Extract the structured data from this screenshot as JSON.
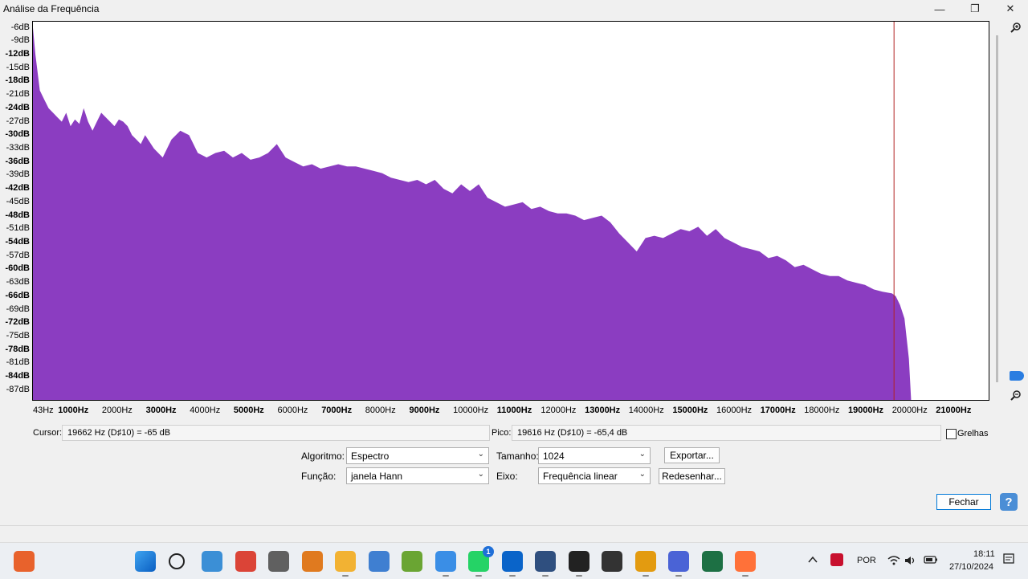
{
  "window": {
    "title": "Análise da Frequência",
    "minimize_glyph": "—",
    "maximize_glyph": "❐",
    "close_glyph": "✕"
  },
  "y_axis": {
    "ticks": [
      "-6dB",
      "-9dB",
      "-12dB",
      "-15dB",
      "-18dB",
      "-21dB",
      "-24dB",
      "-27dB",
      "-30dB",
      "-33dB",
      "-36dB",
      "-39dB",
      "-42dB",
      "-45dB",
      "-48dB",
      "-51dB",
      "-54dB",
      "-57dB",
      "-60dB",
      "-63dB",
      "-66dB",
      "-69dB",
      "-72dB",
      "-75dB",
      "-78dB",
      "-81dB",
      "-84dB",
      "-87dB"
    ]
  },
  "x_axis": {
    "ticks": [
      "43Hz",
      "1000Hz",
      "2000Hz",
      "3000Hz",
      "4000Hz",
      "5000Hz",
      "6000Hz",
      "7000Hz",
      "8000Hz",
      "9000Hz",
      "10000Hz",
      "11000Hz",
      "12000Hz",
      "13000Hz",
      "14000Hz",
      "15000Hz",
      "16000Hz",
      "17000Hz",
      "18000Hz",
      "19000Hz",
      "20000Hz",
      "21000Hz"
    ]
  },
  "chart_data": {
    "type": "area",
    "title": "",
    "xlabel": "",
    "ylabel": "",
    "xlim": [
      0,
      22000
    ],
    "ylim": [
      -89,
      -5
    ],
    "color": "#8b3dc1",
    "cursor_line_hz": 19662,
    "cursor_line_color": "#b22222",
    "x": [
      43,
      100,
      200,
      300,
      400,
      500,
      600,
      700,
      800,
      900,
      1000,
      1100,
      1200,
      1300,
      1400,
      1500,
      1600,
      1700,
      1800,
      1900,
      2000,
      2100,
      2200,
      2300,
      2400,
      2500,
      2600,
      2800,
      3000,
      3200,
      3400,
      3600,
      3800,
      4000,
      4200,
      4400,
      4600,
      4800,
      5000,
      5200,
      5400,
      5600,
      5800,
      6000,
      6200,
      6400,
      6600,
      6800,
      7000,
      7200,
      7400,
      7600,
      7800,
      8000,
      8200,
      8400,
      8600,
      8800,
      9000,
      9200,
      9400,
      9600,
      9800,
      10000,
      10200,
      10400,
      10600,
      10800,
      11000,
      11200,
      11400,
      11600,
      11800,
      12000,
      12200,
      12400,
      12600,
      12800,
      13000,
      13200,
      13400,
      13600,
      13800,
      14000,
      14200,
      14400,
      14600,
      14800,
      15000,
      15200,
      15400,
      15600,
      15800,
      16000,
      16200,
      16400,
      16600,
      16800,
      17000,
      17200,
      17400,
      17600,
      17800,
      18000,
      18200,
      18400,
      18600,
      18800,
      19000,
      19200,
      19400,
      19616,
      19700,
      19800,
      19900,
      20000,
      20050
    ],
    "y": [
      -6,
      -12,
      -20,
      -22,
      -24,
      -25,
      -26,
      -27,
      -25,
      -28,
      -26.5,
      -27.5,
      -24,
      -27,
      -29,
      -27,
      -25,
      -26,
      -27,
      -28,
      -26.5,
      -27,
      -28,
      -30,
      -31,
      -32,
      -30,
      -33,
      -35,
      -31,
      -29,
      -30,
      -34,
      -35,
      -34,
      -33.5,
      -35,
      -34,
      -35.5,
      -35,
      -34,
      -32,
      -35,
      -36,
      -37,
      -36.5,
      -37.5,
      -37,
      -36.5,
      -37,
      -37,
      -37.5,
      -38,
      -38.5,
      -39.5,
      -40,
      -40.5,
      -40,
      -41,
      -40,
      -42,
      -43,
      -41,
      -42.5,
      -41,
      -44,
      -45,
      -46,
      -45.5,
      -45,
      -46.5,
      -46,
      -47,
      -47.5,
      -47.5,
      -48,
      -49,
      -48.5,
      -48,
      -49.5,
      -52,
      -54,
      -56,
      -53,
      -52.5,
      -53,
      -52,
      -51,
      -51.5,
      -50.5,
      -52.5,
      -51,
      -53,
      -54,
      -55,
      -55.5,
      -56,
      -57.5,
      -57,
      -58,
      -59.5,
      -59,
      -60,
      -61,
      -61.5,
      -61.5,
      -62.5,
      -63,
      -63.5,
      -64.5,
      -65,
      -65.4,
      -66,
      -68,
      -71,
      -80,
      -89
    ]
  },
  "status": {
    "cursor_label": "Cursor:",
    "cursor_value": "19662 Hz (D♯10) = -65 dB",
    "peak_label": "Pico:",
    "peak_value": "19616 Hz (D♯10) = -65,4 dB",
    "grid_label": "Grelhas",
    "grid_checked": false
  },
  "controls": {
    "algorithm_label": "Algoritmo:",
    "algorithm_value": "Espectro",
    "size_label": "Tamanho:",
    "size_value": "1024",
    "export_button": "Exportar...",
    "function_label": "Função:",
    "function_value": "janela Hann",
    "axis_label": "Eixo:",
    "axis_value": "Frequência linear",
    "redraw_button": "Redesenhar...",
    "close_button": "Fechar",
    "help_glyph": "?"
  },
  "taskbar": {
    "icons": [
      "weather-icon",
      "start-icon",
      "search-icon",
      "photos-icon",
      "chrome-icon",
      "calculator-icon",
      "media-player-icon",
      "file-explorer-icon",
      "network-icon",
      "utorrent-icon",
      "help-app-icon",
      "whatsapp-icon",
      "outlook-icon",
      "app-icon",
      "audio-editor-icon",
      "media-icon",
      "audacity-icon",
      "bird-app-icon",
      "excel-icon",
      "firefox-icon"
    ],
    "whatsapp_badge": "1",
    "language": "POR",
    "time": "18:11",
    "date": "27/10/2024"
  }
}
